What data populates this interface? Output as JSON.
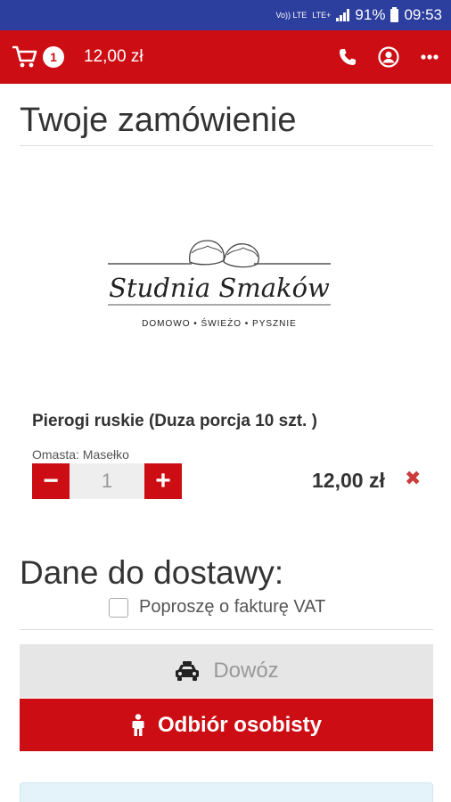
{
  "status_bar": {
    "volte": "Vo)) LTE",
    "lte": "LTE+",
    "battery": "91%",
    "time": "09:53"
  },
  "app_bar": {
    "cart_icon": "cart-icon",
    "cart_count": "1",
    "cart_total": "12,00 zł",
    "actions": [
      "phone-icon",
      "user-icon",
      "more-icon"
    ]
  },
  "page": {
    "title": "Twoje zamówienie"
  },
  "logo": {
    "brand": "Studnia Smaków",
    "tagline": "DOMOWO • ŚWIEŻO • PYSZNIE"
  },
  "order": {
    "items": [
      {
        "name": "Pierogi ruskie (Duza porcja 10 szt. )",
        "option": "Omasta: Masełko",
        "quantity": "1",
        "price": "12,00 zł",
        "remove": "✖",
        "minus": "−",
        "plus": "+"
      }
    ]
  },
  "delivery": {
    "title": "Dane do dostawy:",
    "invoice_label": "Poproszę o fakturę VAT",
    "invoice_checked": false,
    "options": {
      "delivery_label": "Dowóz",
      "pickup_label": "Odbiór osobisty",
      "selected": "pickup"
    }
  },
  "colors": {
    "status_bar": "#2c3e9e",
    "brand_red": "#cc0e14",
    "inactive_button": "#e6e6e6"
  }
}
